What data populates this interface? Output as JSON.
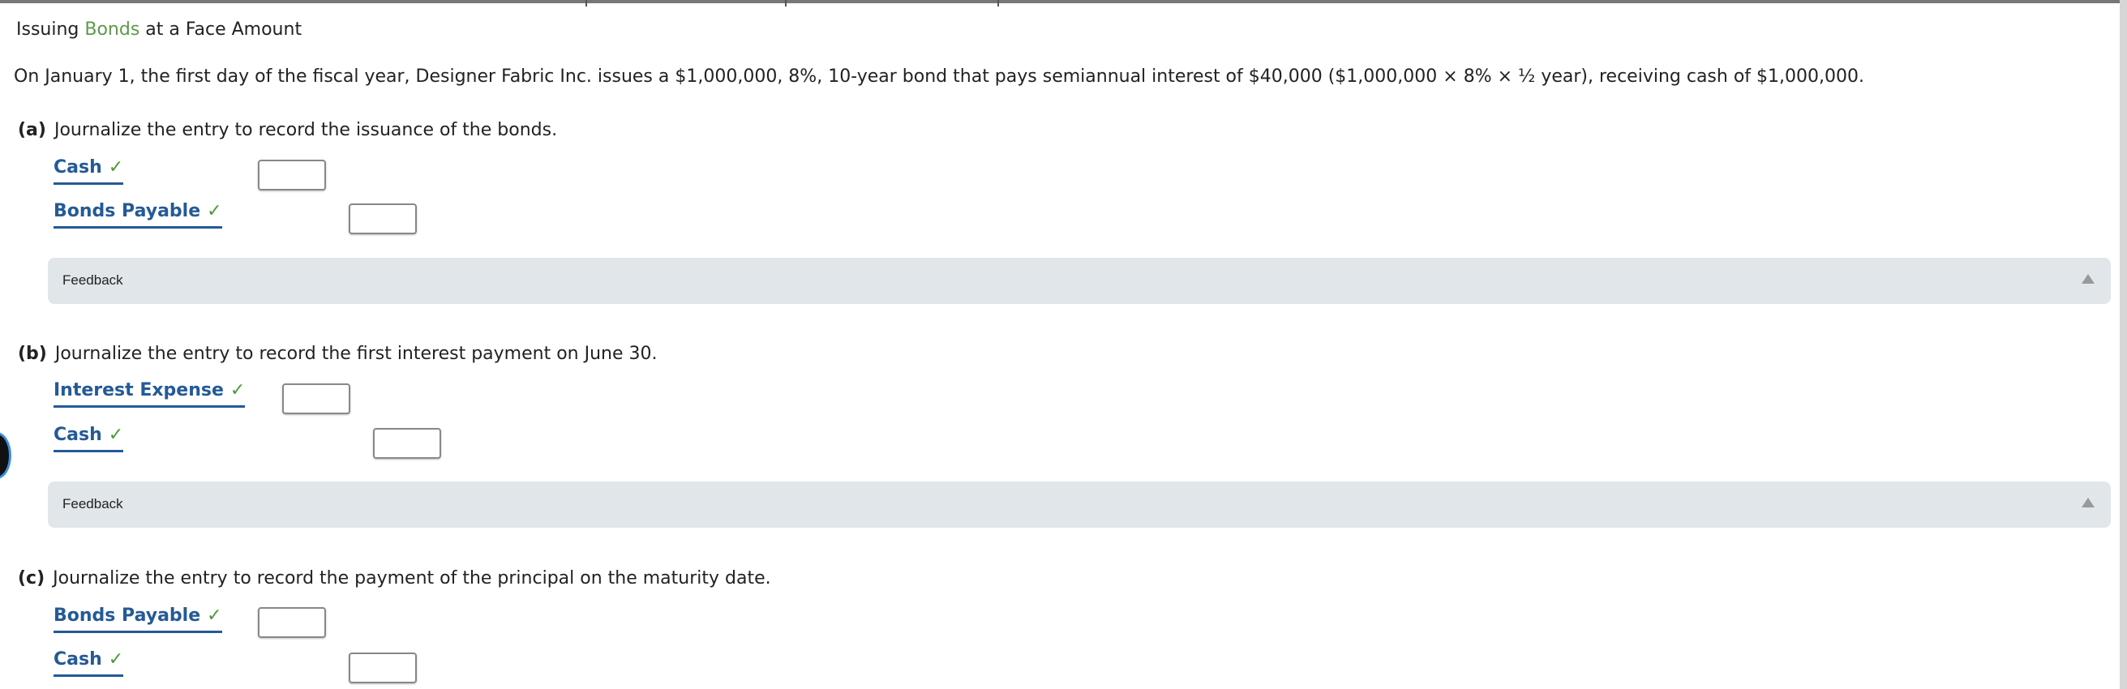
{
  "title": {
    "prefix": "Issuing ",
    "link": "Bonds",
    "suffix": " at a Face Amount"
  },
  "problem": "On January 1, the first day of the fiscal year, Designer Fabric Inc. issues a $1,000,000, 8%, 10-year bond that pays semiannual interest of $40,000 ($1,000,000 × 8% × ½ year), receiving cash of $1,000,000.",
  "parts": [
    {
      "letter": "(a)",
      "text": "Journalize the entry to record the issuance of the bonds.",
      "entries": [
        {
          "account": "Cash",
          "amount": ""
        },
        {
          "account": "Bonds Payable",
          "amount": ""
        }
      ],
      "feedback": "Feedback"
    },
    {
      "letter": "(b)",
      "text": "Journalize the entry to record the first interest payment on June 30.",
      "entries": [
        {
          "account": "Interest Expense",
          "amount": ""
        },
        {
          "account": "Cash",
          "amount": ""
        }
      ],
      "feedback": "Feedback"
    },
    {
      "letter": "(c)",
      "text": "Journalize the entry to record the payment of the principal on the maturity date.",
      "entries": [
        {
          "account": "Bonds Payable",
          "amount": ""
        },
        {
          "account": "Cash",
          "amount": ""
        }
      ]
    }
  ],
  "check_glyph": "✓",
  "colors": {
    "account": "#245a96",
    "check": "#4c9a3b",
    "link": "#5b9a4a",
    "feedback_bg": "#e0e6ea"
  }
}
